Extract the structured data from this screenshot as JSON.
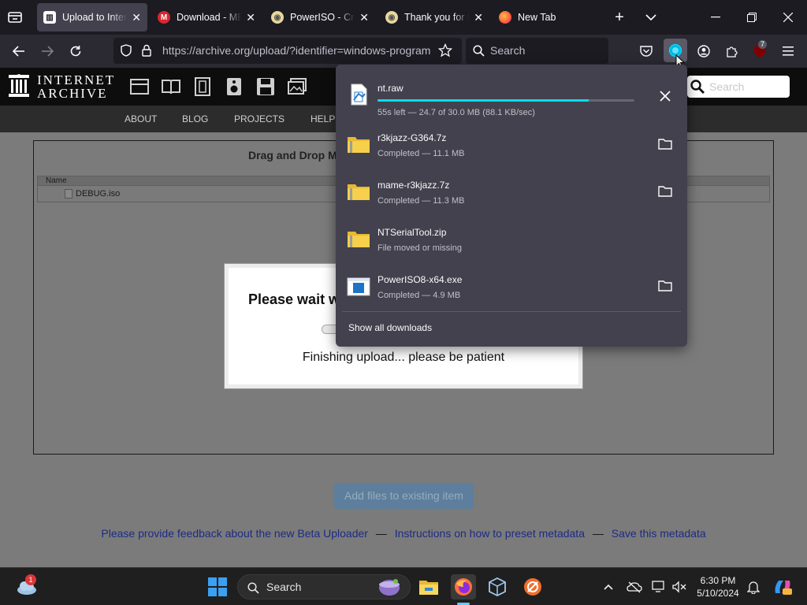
{
  "tabs": [
    {
      "title": "Upload to Internet Archive",
      "active": true
    },
    {
      "title": "Download - MEGA",
      "active": false
    },
    {
      "title": "PowerISO - Create",
      "active": false
    },
    {
      "title": "Thank you for installing",
      "active": false
    },
    {
      "title": "New Tab",
      "active": false
    }
  ],
  "navbar": {
    "url": "https://archive.org/upload/?identifier=windows-program",
    "search_placeholder": "Search",
    "extension_badge": "7"
  },
  "ia": {
    "logo_line1": "INTERNET",
    "logo_line2": "ARCHIVE",
    "search_placeholder": "Search",
    "nav": [
      "ABOUT",
      "BLOG",
      "PROJECTS",
      "HELP"
    ]
  },
  "uploader": {
    "drop_title": "Drag and Drop M",
    "table_header": "Name",
    "file_name": "DEBUG.iso",
    "modal_title": "Please wait w",
    "modal_message": "Finishing upload... please be patient",
    "add_files_label": "Add files to existing item",
    "footer": {
      "feedback": "Please provide feedback about the new Beta Uploader",
      "instructions": "Instructions on how to preset metadata",
      "save": "Save this metadata",
      "separator": "—"
    }
  },
  "downloads": {
    "items": [
      {
        "name": "nt.raw",
        "status": "55s left — 24.7 of 30.0 MB (88.1 KB/sec)",
        "progress": 0.823,
        "icon": "image-file-icon"
      },
      {
        "name": "r3kjazz-G364.7z",
        "status": "Completed — 11.1 MB",
        "icon": "zip-folder-icon"
      },
      {
        "name": "mame-r3kjazz.7z",
        "status": "Completed — 11.3 MB",
        "icon": "zip-folder-icon"
      },
      {
        "name": "NTSerialTool.zip",
        "status": "File moved or missing",
        "icon": "zip-folder-icon"
      },
      {
        "name": "PowerISO8-x64.exe",
        "status": "Completed — 4.9 MB",
        "icon": "exe-file-icon"
      }
    ],
    "show_all": "Show all downloads"
  },
  "taskbar": {
    "search_placeholder": "Search",
    "weather_badge": "1",
    "time": "6:30 PM",
    "date": "5/10/2024"
  },
  "colors": {
    "accent": "#00ddff",
    "panel_bg": "#42414d",
    "link": "#1d2b83"
  }
}
